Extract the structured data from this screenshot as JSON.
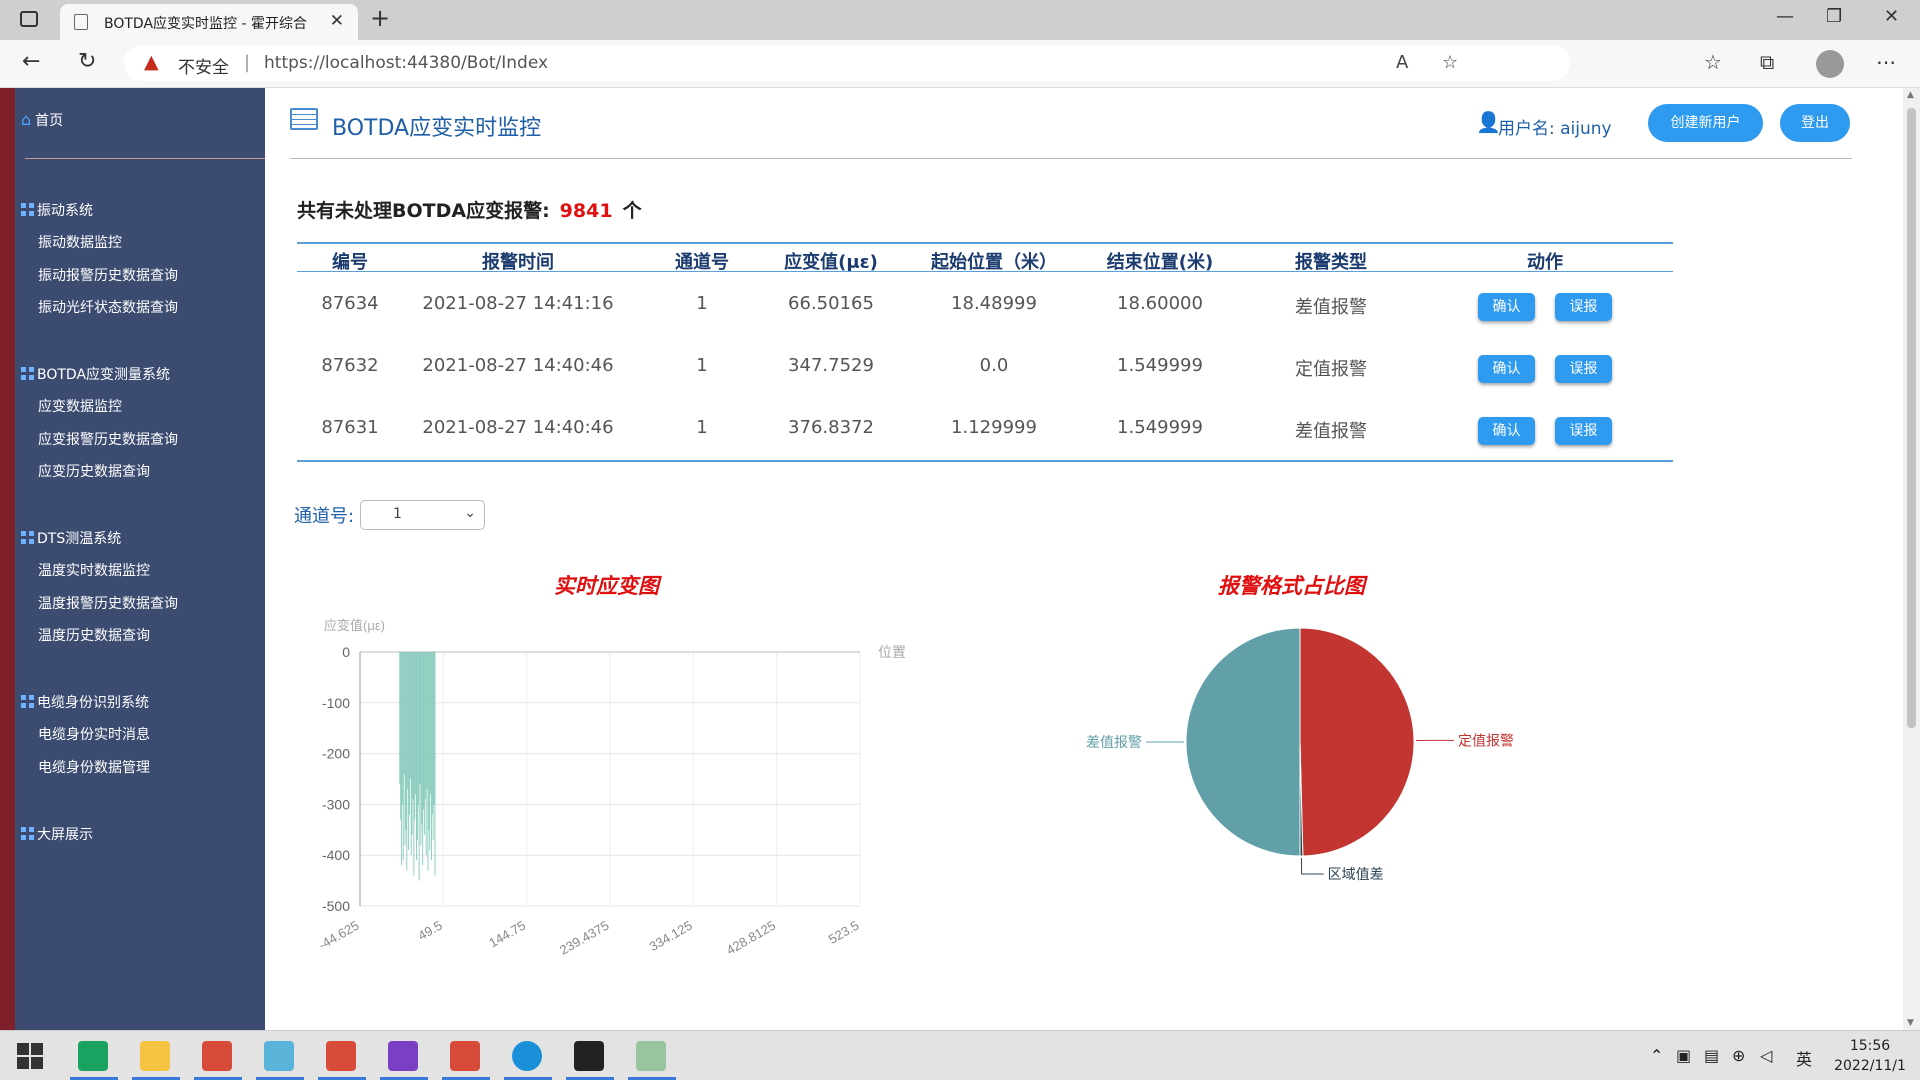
{
  "browser": {
    "tab_title": "BOTDA应变实时监控 - 霍开综合",
    "tab_close": "✕",
    "new_tab": "+",
    "insecure_label": "不安全",
    "url": "https://localhost:44380/Bot/Index"
  },
  "sidebar": {
    "home": "首页",
    "groups": [
      {
        "label": "振动系统",
        "items": [
          "振动数据监控",
          "振动报警历史数据查询",
          "振动光纤状态数据查询"
        ]
      },
      {
        "label": "BOTDA应变测量系统",
        "items": [
          "应变数据监控",
          "应变报警历史数据查询",
          "应变历史数据查询"
        ]
      },
      {
        "label": "DTS测温系统",
        "items": [
          "温度实时数据监控",
          "温度报警历史数据查询",
          "温度历史数据查询"
        ]
      },
      {
        "label": "电缆身份识别系统",
        "items": [
          "电缆身份实时消息",
          "电缆身份数据管理"
        ]
      },
      {
        "label": "大屏展示",
        "items": []
      }
    ]
  },
  "header": {
    "title": "BOTDA应变实时监控",
    "user_label": "用户名: aijuny",
    "create_user": "创建新用户",
    "logout": "登出"
  },
  "summary": {
    "prefix": "共有未处理BOTDA应变报警:",
    "count": "9841",
    "suffix": "个"
  },
  "alarm_table": {
    "columns": [
      "编号",
      "报警时间",
      "通道号",
      "应变值(με)",
      "起始位置（米）",
      "结束位置(米)",
      "报警类型",
      "动作"
    ],
    "rows": [
      [
        "87634",
        "2021-08-27 14:41:16",
        "1",
        "66.50165",
        "18.48999",
        "18.60000",
        "差值报警"
      ],
      [
        "87632",
        "2021-08-27 14:40:46",
        "1",
        "347.7529",
        "0.0",
        "1.549999",
        "定值报警"
      ],
      [
        "87631",
        "2021-08-27 14:40:46",
        "1",
        "376.8372",
        "1.129999",
        "1.549999",
        "差值报警"
      ]
    ],
    "confirm_label": "确认",
    "false_alarm_label": "误报"
  },
  "channel": {
    "label": "通道号:",
    "selected": "1"
  },
  "chart_data": [
    {
      "type": "bar",
      "title": "实时应变图",
      "xlabel": "位置",
      "ylabel": "应变值(με)",
      "x_tick_labels": [
        "-44.625",
        "49.5",
        "144.75",
        "239.4375",
        "334.125",
        "428.8125",
        "523.5"
      ],
      "y_tick_labels": [
        "0",
        "-100",
        "-200",
        "-300",
        "-400",
        "-500"
      ],
      "xlim": [
        -44.625,
        523.5
      ],
      "ylim": [
        -500,
        0
      ],
      "grid": true,
      "color": "#7cc7b6",
      "x_start": 0,
      "x_end": 40,
      "values": [
        -260,
        -330,
        -420,
        -300,
        -410,
        -240,
        -380,
        -350,
        -430,
        -270,
        -390,
        -320,
        -250,
        -400,
        -360,
        -290,
        -440,
        -330,
        -280,
        -410,
        -370,
        -300,
        -450,
        -260,
        -380,
        -340,
        -420,
        -310,
        -360,
        -290,
        -400,
        -270,
        -430,
        -350,
        -390,
        -280,
        -410,
        -320,
        -370,
        -300,
        -440
      ]
    },
    {
      "type": "pie",
      "title": "报警格式占比图",
      "slices": [
        {
          "label": "定值报警",
          "value": 49.6,
          "color": "#c23531"
        },
        {
          "label": "区域值差",
          "value": 0.4,
          "color": "#2f4554"
        },
        {
          "label": "差值报警",
          "value": 50.0,
          "color": "#61a0a8"
        }
      ]
    }
  ],
  "taskbar": {
    "clock_time": "15:56",
    "clock_date": "2022/11/1",
    "ime": "英"
  }
}
